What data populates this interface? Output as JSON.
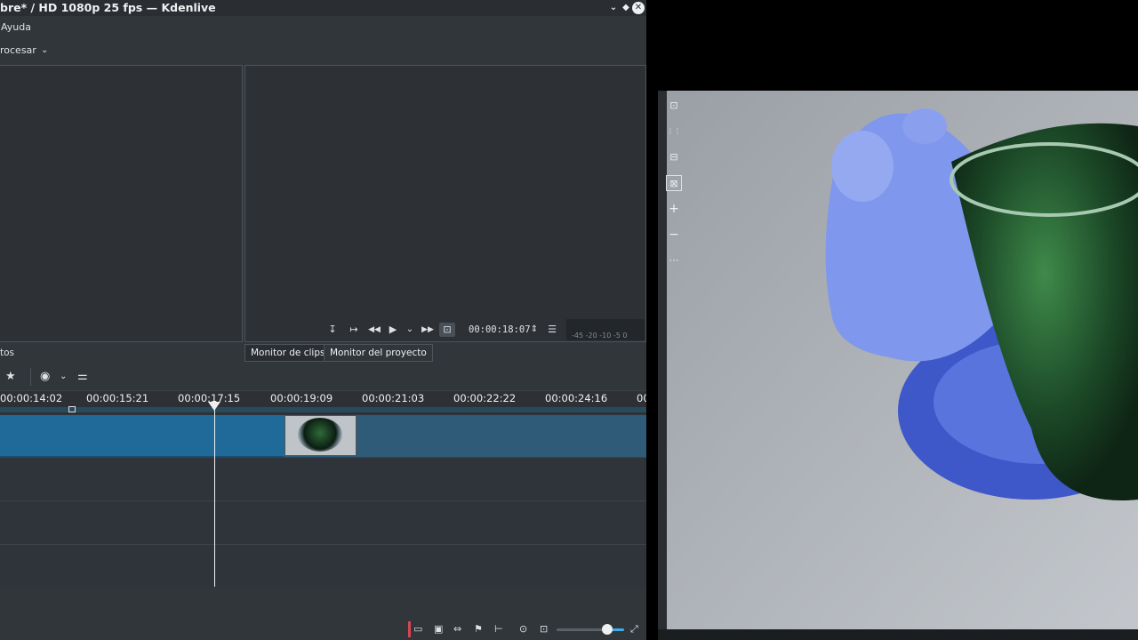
{
  "window": {
    "title": "bre* / HD 1080p 25 fps — Kdenlive",
    "controls": [
      "⌄",
      "◆",
      "✕"
    ]
  },
  "menubar": {
    "items": [
      "Ayuda"
    ]
  },
  "toolbar": {
    "render_label": "rocesar"
  },
  "project_monitor": {
    "timecode": "00:00:18:07",
    "audio_scale": "-45 -20 -10 -5 0"
  },
  "tabs": [
    {
      "label": "tos"
    },
    {
      "label": "Monitor de clips"
    },
    {
      "label": "Monitor del proyecto"
    }
  ],
  "timeline": {
    "ruler_labels": [
      "00:00:14:02",
      "00:00:15:21",
      "00:00:17:15",
      "00:00:19:09",
      "00:00:21:03",
      "00:00:22:22",
      "00:00:24:16",
      "00"
    ]
  },
  "icons": {
    "zone_in": "↧",
    "zone_out": "↦",
    "rewind": "◀◀",
    "play": "▶",
    "play_menu": "⌄",
    "forward": "▶▶",
    "crop": "⊡",
    "spin": "⇕",
    "menu": "☰",
    "star": "★",
    "circle_dot": "◉",
    "chevron": "⌄",
    "sliders": "⚌",
    "monitor_tools": [
      "⊡",
      "⋮⋮",
      "⊟",
      "⊠",
      "+",
      "−",
      "⋯"
    ],
    "bottom": [
      "▭",
      "▣",
      "⇔",
      "⚑",
      "⊢",
      "⊙",
      "⊡",
      "⤢"
    ]
  },
  "colors": {
    "accent": "#1f6a99",
    "background": "#31363b"
  }
}
